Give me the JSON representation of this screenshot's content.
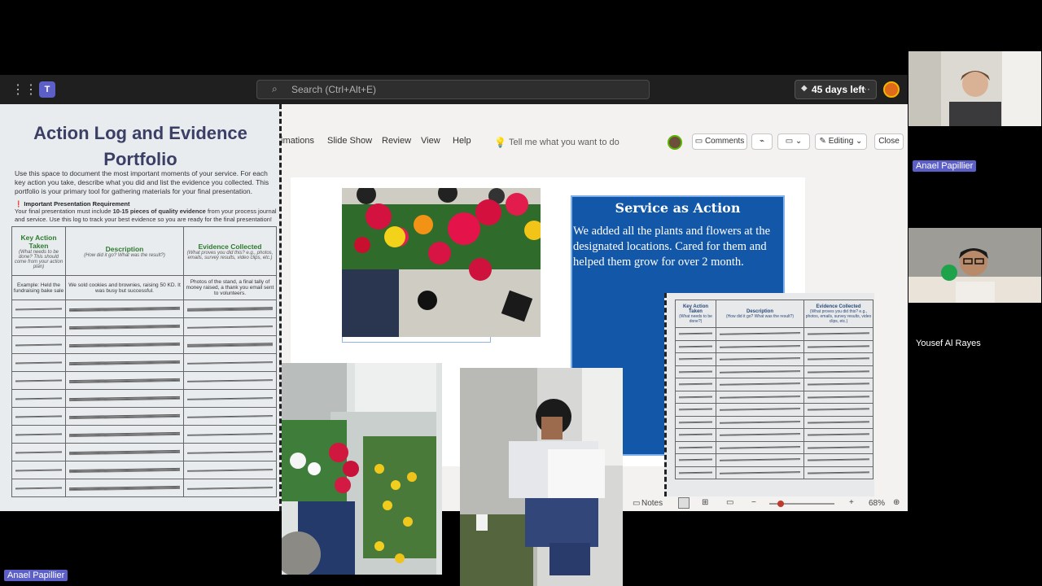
{
  "teams_bar": {
    "search_placeholder": "Search (Ctrl+Alt+E)",
    "trial_label": "45 days left",
    "more": "···"
  },
  "ribbon": {
    "tabs": [
      "imations",
      "Slide Show",
      "Review",
      "View",
      "Help"
    ],
    "tell_me": "Tell me what you want to do",
    "comments": "Comments",
    "editing": "Editing",
    "close": "Close"
  },
  "status_bar": {
    "notes": "Notes",
    "zoom": "68%"
  },
  "slide": {
    "service_title": "Service as Action",
    "service_body": "We added all the plants and flowers at the designated locations. Cared for them and helped them grow for over 2 month."
  },
  "document": {
    "title": "Action Log and Evidence Portfolio",
    "intro": "Use this space to document the most important moments of your service. For each key action you take, describe what you did and list the evidence you collected. This portfolio is your primary tool for gathering materials for your final presentation.",
    "req_title": "❗ Important Presentation Requirement",
    "req_body_1": "Your final presentation must include ",
    "req_body_bold": "10-15 pieces of quality evidence",
    "req_body_2": " from your process journal and service. Use this log to track your best evidence so you are ready for the final presentation!",
    "headers": [
      {
        "title": "Key Action Taken",
        "sub": "(What needs to be done? This should come from your action plan)"
      },
      {
        "title": "Description",
        "sub": "(How did it go? What was the result?)"
      },
      {
        "title": "Evidence Collected",
        "sub": "(What proves you did this? e.g., photos, emails, survey results, video clips, etc.)"
      }
    ],
    "example_row": [
      "Example: Held the fundraising bake sale",
      "We sold cookies and brownies, raising 50 KD. It was busy but successful.",
      "Photos of the stand, a final tally of money raised, a thank you email sent to volunteers."
    ]
  },
  "doc2": {
    "headers": [
      {
        "title": "Key Action Taken",
        "sub": "(What needs to be done?)"
      },
      {
        "title": "Description",
        "sub": "(How did it go? What was the result?)"
      },
      {
        "title": "Evidence Collected",
        "sub": "(What proves you did this? e.g., photos, emails, survey results, video clips, etc.)"
      }
    ]
  },
  "participants": {
    "anael": "Anael Papillier",
    "yousef": "Yousef Al Rayes",
    "presenter_tag": "Anael Papillier"
  },
  "colors": {
    "teams_accent": "#5b5fc7",
    "slide_blue": "#1357a8"
  }
}
